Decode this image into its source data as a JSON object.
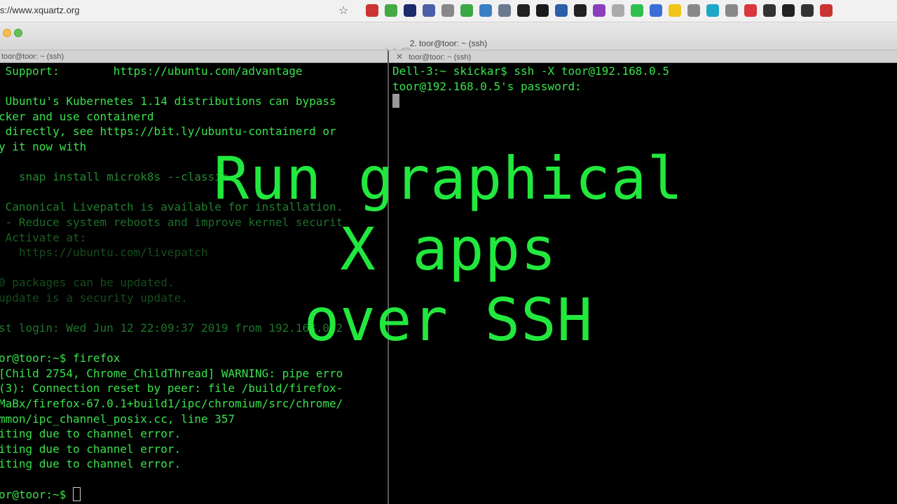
{
  "browser": {
    "url": "s://www.xquartz.org",
    "bookmark_icon": "star-icon",
    "extension_colors": [
      "#cc3333",
      "#44aa44",
      "#1b2a6b",
      "#4a5fa8",
      "#888888",
      "#39a845",
      "#3b7fc4",
      "#6b7a8f",
      "#222222",
      "#1a1a1a",
      "#2d5fa8",
      "#222222",
      "#8b3fbf",
      "#aaaaaa",
      "#2fbf4f",
      "#3a6fd8",
      "#f0c419",
      "#888888",
      "#1ea7c8",
      "#888888",
      "#d9363e",
      "#333333",
      "#222222",
      "#333333",
      "#cc3333"
    ]
  },
  "window": {
    "title": "2. toor@toor: ~ (ssh)",
    "ghost_title": "XQuartz"
  },
  "tabs": {
    "left_label": "toor@toor: ~ (ssh)",
    "right_close": "✕",
    "right_label": "toor@toor: ~ (ssh)"
  },
  "left_pane": {
    "lines": [
      " Support:        https://ubuntu.com/advantage",
      "",
      " Ubuntu's Kubernetes 1.14 distributions can bypass",
      "cker and use containerd",
      " directly, see https://bit.ly/ubuntu-containerd or",
      "y it now with",
      "",
      "   snap install microk8s --classic",
      "",
      " Canonical Livepatch is available for installation.",
      " - Reduce system reboots and improve kernel securit",
      " Activate at:",
      "   https://ubuntu.com/livepatch",
      "",
      "0 packages can be updated.",
      "update is a security update.",
      "",
      "st login: Wed Jun 12 22:09:37 2019 from 192.168.0.2",
      "",
      "or@toor:~$ firefox",
      "[Child 2754, Chrome_ChildThread] WARNING: pipe erro",
      "(3): Connection reset by peer: file /build/firefox-",
      "MaBx/firefox-67.0.1+build1/ipc/chromium/src/chrome/",
      "mmon/ipc_channel_posix.cc, line 357",
      "iting due to channel error.",
      "iting due to channel error.",
      "iting due to channel error.",
      "",
      "or@toor:~$ "
    ]
  },
  "right_pane": {
    "line1": "Dell-3:~ skickar$ ssh -X toor@192.168.0.5",
    "line2": "toor@192.168.0.5's password:"
  },
  "overlay": {
    "line1": "Run graphical",
    "line2": "X apps",
    "line3": "over SSH"
  }
}
